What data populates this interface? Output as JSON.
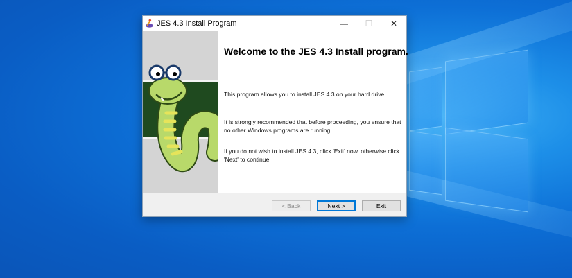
{
  "window": {
    "title": "JES 4.3 Install Program",
    "controls": {
      "minimize": "—",
      "maximize": "☐",
      "close": "✕"
    }
  },
  "content": {
    "heading": "Welcome to the JES 4.3 Install program.",
    "paragraphs": [
      "This program allows you to install JES 4.3 on your hard drive.",
      "It is strongly recommended that before proceeding, you ensure that no other Windows programs are running.",
      "If you do not wish to install JES 4.3, click 'Exit' now, otherwise click 'Next' to continue."
    ]
  },
  "buttons": {
    "back": "< Back",
    "next": "Next >",
    "exit": "Exit"
  },
  "icons": {
    "app": "jes-snake-icon",
    "mascot": "jes-snake-mascot"
  },
  "colors": {
    "desktop": "#0a6fd0",
    "accent": "#0078d7",
    "mascot_body": "#b8d96a",
    "mascot_band": "#1f4a1f"
  }
}
